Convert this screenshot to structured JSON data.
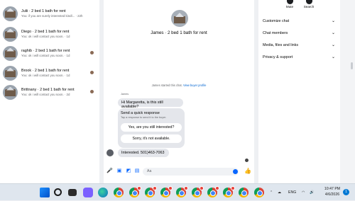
{
  "conversations": [
    {
      "title": "Julii · 2 bed 1 bath for rent",
      "preview": "You: if you are surely interested kindl... · 22h",
      "seen": false
    },
    {
      "title": "Diego · 2 bed 1 bath for rent",
      "preview": "You: ok i will contact you soon. · 1d",
      "seen": false
    },
    {
      "title": "raghib · 2 bed 1 bath for rent",
      "preview": "You: ok i will contact you soon. · 1d",
      "seen": true
    },
    {
      "title": "Brook · 2 bed 1 bath for rent",
      "preview": "You: ok i will contact you soon. · 1d",
      "seen": true
    },
    {
      "title": "Brittnany · 2 bed 1 bath for rent",
      "preview": "You: ok i will contact you soon. · 2d",
      "seen": true
    }
  ],
  "chat": {
    "header_title": "James · 2 bed 1 bath for rent",
    "started_text": "James started this chat.",
    "view_profile": "View buyer profile",
    "sender_name": "James",
    "first_message": "Hi Margaretta, is this still available?",
    "quick_response": {
      "title": "Send a quick response",
      "subtitle": "Tap a response to send it to the buyer.",
      "option1": "Yes, are you still interested?",
      "option2": "Sorry, it's not available."
    },
    "second_message": "Interested. 501)463-7063",
    "composer_placeholder": "Aa"
  },
  "right_panel": {
    "mute_label": "Mute",
    "search_label": "Search",
    "sections": [
      "Customize chat",
      "Chat members",
      "Media, files and links",
      "Privacy & support"
    ]
  },
  "taskbar": {
    "language": "ENG",
    "time": "10:47 PM",
    "date": "4/6/2026",
    "notification_count": "1"
  },
  "colors": {
    "accent": "#0866ff",
    "bubble": "#e4e6eb",
    "taskbar": "#dfe6ee"
  }
}
